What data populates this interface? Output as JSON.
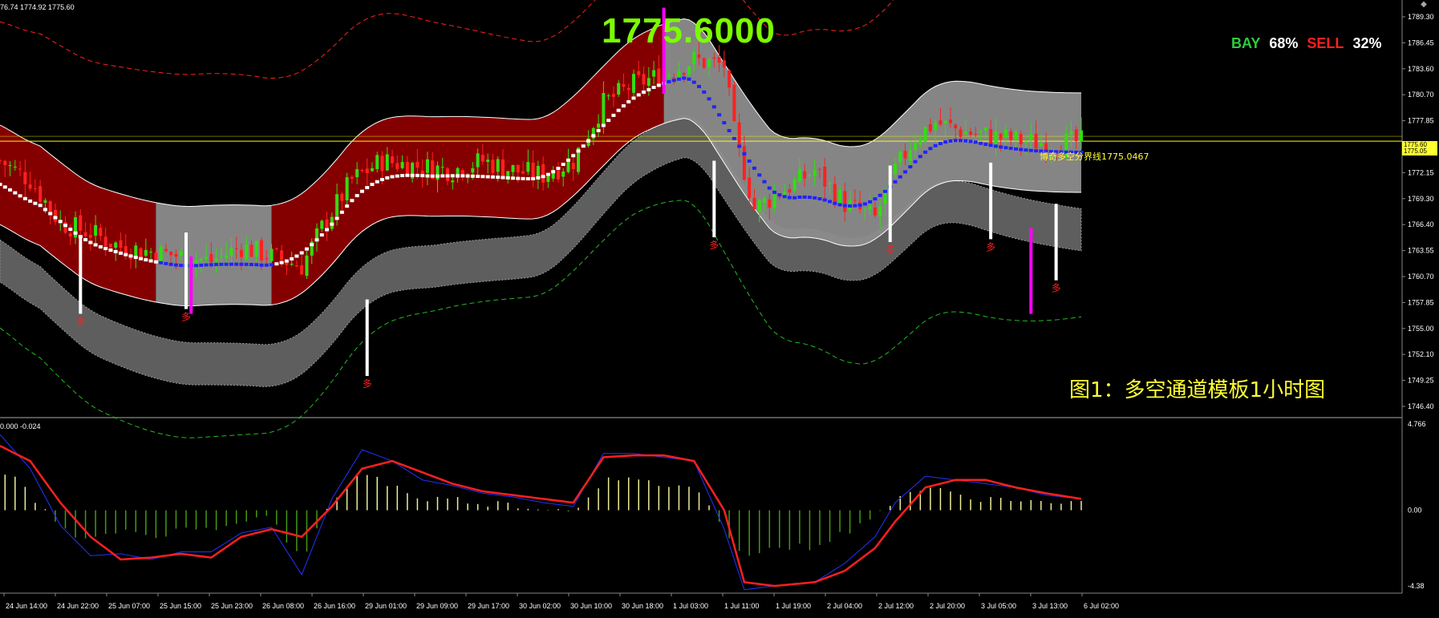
{
  "header": {
    "ohlc_text": "76.74 1774.92 1775.60",
    "indicator_text": "0.000 -0.024"
  },
  "big_price": "1775.6000",
  "sentiment": {
    "bay_label": "BAY",
    "bay_value": "68%",
    "sell_label": "SELL",
    "sell_value": "32%"
  },
  "caption": "图1：多空通道模板1小时图",
  "midline_label": "博奇多空分界线1775.0467",
  "price_tag": {
    "a": "1775.60",
    "b": "1775.05"
  },
  "signal_glyph": "多",
  "colors": {
    "background": "#000000",
    "up_candle": "#33dd11",
    "down_candle": "#ff2020",
    "upper_band_fill": "#8b0000",
    "lower_band_fill": "#8c8c8c",
    "bull_dots": "#ffffff",
    "bear_dots": "#2222ff",
    "signal_bar": "#ff00ff",
    "outer_upper": "#ff2020",
    "outer_lower": "#22bb22",
    "price_line": "#ffff00",
    "axis_text": "#ffffff",
    "macd_pos": "#eeee99",
    "macd_neg": "#449911",
    "signal_line": "#ff2020",
    "macd_line": "#2233ff"
  },
  "chart_data": [
    {
      "type": "candlestick",
      "price_axis": {
        "ticks": [
          "1789.30",
          "1786.45",
          "1783.60",
          "1780.70",
          "1777.85",
          "1775.00",
          "1772.15",
          "1769.30",
          "1766.40",
          "1763.55",
          "1760.70",
          "1757.85",
          "1755.00",
          "1752.10",
          "1749.25",
          "1746.40"
        ],
        "range": [
          1746.4,
          1789.3
        ]
      },
      "time_axis": {
        "ticks": [
          "24 Jun 14:00",
          "24 Jun 22:00",
          "25 Jun 07:00",
          "25 Jun 15:00",
          "25 Jun 23:00",
          "26 Jun 08:00",
          "26 Jun 16:00",
          "29 Jun 01:00",
          "29 Jun 09:00",
          "29 Jun 17:00",
          "30 Jun 02:00",
          "30 Jun 10:00",
          "30 Jun 18:00",
          "1 Jul 03:00",
          "1 Jul 11:00",
          "1 Jul 19:00",
          "2 Jul 04:00",
          "2 Jul 12:00",
          "2 Jul 20:00",
          "3 Jul 05:00",
          "3 Jul 13:00",
          "6 Jul 02:00"
        ]
      },
      "close_path": [
        [
          0,
          1773.0
        ],
        [
          6,
          1771.0
        ],
        [
          12,
          1766.5
        ],
        [
          18,
          1765.5
        ],
        [
          24,
          1764.0
        ],
        [
          30,
          1763.5
        ],
        [
          36,
          1763.0
        ],
        [
          42,
          1762.5
        ],
        [
          48,
          1764.0
        ],
        [
          54,
          1763.0
        ],
        [
          60,
          1762.0
        ],
        [
          64,
          1766.0
        ],
        [
          70,
          1771.0
        ],
        [
          76,
          1773.0
        ],
        [
          82,
          1772.5
        ],
        [
          90,
          1772.0
        ],
        [
          96,
          1773.0
        ],
        [
          102,
          1772.0
        ],
        [
          108,
          1771.5
        ],
        [
          114,
          1773.0
        ],
        [
          120,
          1779.0
        ],
        [
          126,
          1781.0
        ],
        [
          132,
          1782.0
        ],
        [
          138,
          1783.5
        ],
        [
          144,
          1783.0
        ],
        [
          146,
          1776.0
        ],
        [
          150,
          1768.0
        ],
        [
          156,
          1770.0
        ],
        [
          162,
          1772.0
        ],
        [
          168,
          1768.5
        ],
        [
          174,
          1767.0
        ],
        [
          178,
          1772.0
        ],
        [
          182,
          1775.5
        ],
        [
          186,
          1777.0
        ],
        [
          192,
          1776.0
        ],
        [
          198,
          1775.5
        ],
        [
          204,
          1775.0
        ],
        [
          210,
          1774.8
        ],
        [
          215,
          1775.0
        ]
      ],
      "midline_value": 1775.0467,
      "current_price": 1775.6,
      "signals": [
        {
          "bar": 16,
          "price": 1757.0
        },
        {
          "bar": 37,
          "price": 1757.5
        },
        {
          "bar": 73,
          "price": 1750.5
        },
        {
          "bar": 142,
          "price": 1765.0
        },
        {
          "bar": 177,
          "price": 1764.5
        },
        {
          "bar": 197,
          "price": 1764.8
        },
        {
          "bar": 210,
          "price": 1760.5
        }
      ]
    },
    {
      "type": "histogram+line",
      "axis_ticks": [
        "4.766",
        "0.00",
        "-4.38"
      ],
      "range": [
        -4.38,
        4.766
      ],
      "signal_line": [
        [
          0,
          3.4
        ],
        [
          6,
          2.6
        ],
        [
          12,
          0.4
        ],
        [
          18,
          -1.4
        ],
        [
          24,
          -2.6
        ],
        [
          30,
          -2.5
        ],
        [
          36,
          -2.3
        ],
        [
          42,
          -2.5
        ],
        [
          48,
          -1.4
        ],
        [
          54,
          -1.0
        ],
        [
          60,
          -1.4
        ],
        [
          66,
          0.2
        ],
        [
          72,
          2.2
        ],
        [
          78,
          2.6
        ],
        [
          84,
          2.0
        ],
        [
          90,
          1.4
        ],
        [
          96,
          1.0
        ],
        [
          102,
          0.8
        ],
        [
          108,
          0.6
        ],
        [
          114,
          0.4
        ],
        [
          120,
          2.8
        ],
        [
          126,
          2.9
        ],
        [
          132,
          2.9
        ],
        [
          138,
          2.6
        ],
        [
          144,
          0.0
        ],
        [
          148,
          -3.8
        ],
        [
          154,
          -4.0
        ],
        [
          162,
          -3.8
        ],
        [
          168,
          -3.2
        ],
        [
          174,
          -2.0
        ],
        [
          178,
          -0.6
        ],
        [
          184,
          1.2
        ],
        [
          190,
          1.6
        ],
        [
          196,
          1.6
        ],
        [
          202,
          1.2
        ],
        [
          208,
          0.9
        ],
        [
          215,
          0.6
        ]
      ],
      "macd_line": [
        [
          0,
          4.0
        ],
        [
          6,
          2.2
        ],
        [
          12,
          -0.8
        ],
        [
          18,
          -2.4
        ],
        [
          24,
          -2.3
        ],
        [
          30,
          -2.6
        ],
        [
          36,
          -2.2
        ],
        [
          42,
          -2.2
        ],
        [
          48,
          -1.2
        ],
        [
          54,
          -0.9
        ],
        [
          60,
          -3.4
        ],
        [
          66,
          0.6
        ],
        [
          72,
          3.2
        ],
        [
          78,
          2.6
        ],
        [
          84,
          1.6
        ],
        [
          90,
          1.3
        ],
        [
          96,
          0.9
        ],
        [
          102,
          0.7
        ],
        [
          108,
          0.4
        ],
        [
          114,
          0.2
        ],
        [
          120,
          3.0
        ],
        [
          126,
          3.0
        ],
        [
          132,
          2.8
        ],
        [
          138,
          2.6
        ],
        [
          144,
          -1.0
        ],
        [
          148,
          -4.2
        ],
        [
          154,
          -4.0
        ],
        [
          162,
          -3.8
        ],
        [
          168,
          -2.8
        ],
        [
          174,
          -1.4
        ],
        [
          178,
          0.4
        ],
        [
          184,
          1.8
        ],
        [
          190,
          1.6
        ],
        [
          196,
          1.4
        ],
        [
          202,
          1.2
        ],
        [
          208,
          0.8
        ],
        [
          215,
          0.6
        ]
      ]
    }
  ]
}
